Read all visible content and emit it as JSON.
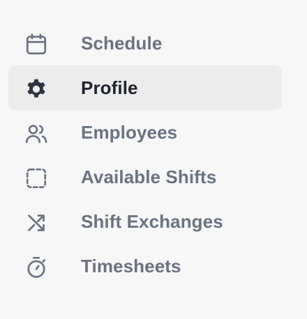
{
  "sidebar": {
    "items": [
      {
        "label": "Schedule",
        "icon": "calendar-icon",
        "active": false
      },
      {
        "label": "Profile",
        "icon": "gear-icon",
        "active": true
      },
      {
        "label": "Employees",
        "icon": "users-icon",
        "active": false
      },
      {
        "label": "Available Shifts",
        "icon": "dashed-square-icon",
        "active": false
      },
      {
        "label": "Shift Exchanges",
        "icon": "shuffle-icon",
        "active": false
      },
      {
        "label": "Timesheets",
        "icon": "stopwatch-icon",
        "active": false
      }
    ]
  },
  "colors": {
    "background": "#f7f7f7",
    "active_background": "#ececec",
    "muted_text": "#6b7280",
    "active_text": "#1f232b"
  }
}
